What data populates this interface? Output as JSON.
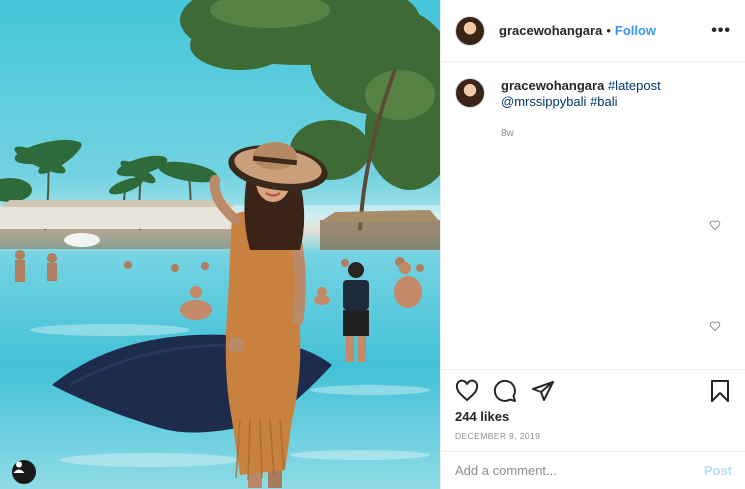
{
  "post": {
    "image_alt": "Woman in sun hat and orange dress standing in a resort pool"
  },
  "header": {
    "username": "gracewohangara",
    "separator": "•",
    "follow_label": "Follow",
    "more_label": "•••"
  },
  "caption": {
    "username": "gracewohangara",
    "hashtag1": "#latepost",
    "mention": "@mrssippybali",
    "hashtag2": "#bali",
    "time_ago": "8w"
  },
  "actions": {
    "icons": [
      "heart-icon",
      "comment-icon",
      "share-icon",
      "bookmark-icon"
    ],
    "likes": "244 likes",
    "date": "DECEMBER 9, 2019"
  },
  "comment_box": {
    "placeholder": "Add a comment...",
    "post_label": "Post"
  },
  "colors": {
    "link": "#3897f0",
    "hashtag": "#00376b",
    "post_disabled": "#b2dffc",
    "muted": "#8e8e8e"
  }
}
